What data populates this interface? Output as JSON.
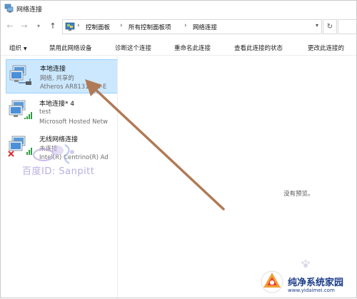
{
  "window": {
    "title": "网络连接"
  },
  "nav": {
    "back": "←",
    "forward": "→",
    "dropdown": "▾",
    "up": "↑",
    "refresh": "↻",
    "address_dropdown": "▾"
  },
  "breadcrumb": {
    "items": [
      "控制面板",
      "所有控制面板项",
      "网络连接"
    ],
    "separator": "›"
  },
  "toolbar": {
    "organize": "组织",
    "disable": "禁用此网络设备",
    "diagnose": "诊断这个连接",
    "rename": "重命名此连接",
    "view_status": "查看此连接的状态",
    "change_settings": "更改此连接的"
  },
  "connections": [
    {
      "name": "本地连接",
      "status": "网络, 共享的",
      "device": "Atheros AR8131 PCI-E",
      "selected": true,
      "icon": "wired-network-icon"
    },
    {
      "name": "本地连接* 4",
      "status": "test",
      "device": "Microsoft Hosted Netw",
      "selected": false,
      "icon": "wired-network-icon"
    },
    {
      "name": "无线网络连接",
      "status": "未连接",
      "device": "Intel(R) Centrino(R) Ad",
      "selected": false,
      "icon": "wireless-disconnected-icon"
    }
  ],
  "preview": {
    "text": "没有预览。"
  },
  "watermark": {
    "baidu": "百度ID: Sanpitt"
  },
  "site": {
    "name": "纯净系统家园",
    "url": "www.yidaimei.com"
  },
  "colors": {
    "selection": "#cce8ff",
    "selection_border": "#99d1ff",
    "arrow": "#b07a55",
    "site_text": "#1d3d8a"
  }
}
